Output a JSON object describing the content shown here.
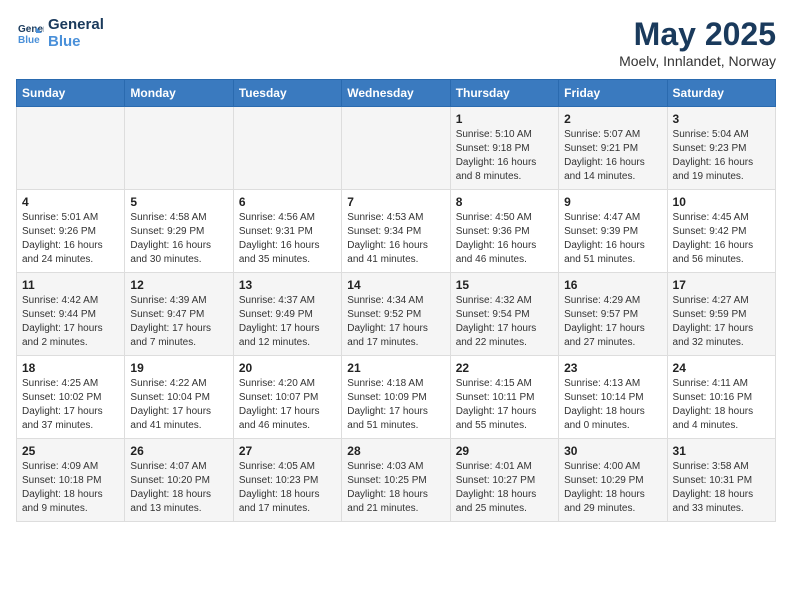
{
  "header": {
    "logo_line1": "General",
    "logo_line2": "Blue",
    "month": "May 2025",
    "location": "Moelv, Innlandet, Norway"
  },
  "days_of_week": [
    "Sunday",
    "Monday",
    "Tuesday",
    "Wednesday",
    "Thursday",
    "Friday",
    "Saturday"
  ],
  "weeks": [
    [
      {
        "day": "",
        "content": ""
      },
      {
        "day": "",
        "content": ""
      },
      {
        "day": "",
        "content": ""
      },
      {
        "day": "",
        "content": ""
      },
      {
        "day": "1",
        "content": "Sunrise: 5:10 AM\nSunset: 9:18 PM\nDaylight: 16 hours\nand 8 minutes."
      },
      {
        "day": "2",
        "content": "Sunrise: 5:07 AM\nSunset: 9:21 PM\nDaylight: 16 hours\nand 14 minutes."
      },
      {
        "day": "3",
        "content": "Sunrise: 5:04 AM\nSunset: 9:23 PM\nDaylight: 16 hours\nand 19 minutes."
      }
    ],
    [
      {
        "day": "4",
        "content": "Sunrise: 5:01 AM\nSunset: 9:26 PM\nDaylight: 16 hours\nand 24 minutes."
      },
      {
        "day": "5",
        "content": "Sunrise: 4:58 AM\nSunset: 9:29 PM\nDaylight: 16 hours\nand 30 minutes."
      },
      {
        "day": "6",
        "content": "Sunrise: 4:56 AM\nSunset: 9:31 PM\nDaylight: 16 hours\nand 35 minutes."
      },
      {
        "day": "7",
        "content": "Sunrise: 4:53 AM\nSunset: 9:34 PM\nDaylight: 16 hours\nand 41 minutes."
      },
      {
        "day": "8",
        "content": "Sunrise: 4:50 AM\nSunset: 9:36 PM\nDaylight: 16 hours\nand 46 minutes."
      },
      {
        "day": "9",
        "content": "Sunrise: 4:47 AM\nSunset: 9:39 PM\nDaylight: 16 hours\nand 51 minutes."
      },
      {
        "day": "10",
        "content": "Sunrise: 4:45 AM\nSunset: 9:42 PM\nDaylight: 16 hours\nand 56 minutes."
      }
    ],
    [
      {
        "day": "11",
        "content": "Sunrise: 4:42 AM\nSunset: 9:44 PM\nDaylight: 17 hours\nand 2 minutes."
      },
      {
        "day": "12",
        "content": "Sunrise: 4:39 AM\nSunset: 9:47 PM\nDaylight: 17 hours\nand 7 minutes."
      },
      {
        "day": "13",
        "content": "Sunrise: 4:37 AM\nSunset: 9:49 PM\nDaylight: 17 hours\nand 12 minutes."
      },
      {
        "day": "14",
        "content": "Sunrise: 4:34 AM\nSunset: 9:52 PM\nDaylight: 17 hours\nand 17 minutes."
      },
      {
        "day": "15",
        "content": "Sunrise: 4:32 AM\nSunset: 9:54 PM\nDaylight: 17 hours\nand 22 minutes."
      },
      {
        "day": "16",
        "content": "Sunrise: 4:29 AM\nSunset: 9:57 PM\nDaylight: 17 hours\nand 27 minutes."
      },
      {
        "day": "17",
        "content": "Sunrise: 4:27 AM\nSunset: 9:59 PM\nDaylight: 17 hours\nand 32 minutes."
      }
    ],
    [
      {
        "day": "18",
        "content": "Sunrise: 4:25 AM\nSunset: 10:02 PM\nDaylight: 17 hours\nand 37 minutes."
      },
      {
        "day": "19",
        "content": "Sunrise: 4:22 AM\nSunset: 10:04 PM\nDaylight: 17 hours\nand 41 minutes."
      },
      {
        "day": "20",
        "content": "Sunrise: 4:20 AM\nSunset: 10:07 PM\nDaylight: 17 hours\nand 46 minutes."
      },
      {
        "day": "21",
        "content": "Sunrise: 4:18 AM\nSunset: 10:09 PM\nDaylight: 17 hours\nand 51 minutes."
      },
      {
        "day": "22",
        "content": "Sunrise: 4:15 AM\nSunset: 10:11 PM\nDaylight: 17 hours\nand 55 minutes."
      },
      {
        "day": "23",
        "content": "Sunrise: 4:13 AM\nSunset: 10:14 PM\nDaylight: 18 hours\nand 0 minutes."
      },
      {
        "day": "24",
        "content": "Sunrise: 4:11 AM\nSunset: 10:16 PM\nDaylight: 18 hours\nand 4 minutes."
      }
    ],
    [
      {
        "day": "25",
        "content": "Sunrise: 4:09 AM\nSunset: 10:18 PM\nDaylight: 18 hours\nand 9 minutes."
      },
      {
        "day": "26",
        "content": "Sunrise: 4:07 AM\nSunset: 10:20 PM\nDaylight: 18 hours\nand 13 minutes."
      },
      {
        "day": "27",
        "content": "Sunrise: 4:05 AM\nSunset: 10:23 PM\nDaylight: 18 hours\nand 17 minutes."
      },
      {
        "day": "28",
        "content": "Sunrise: 4:03 AM\nSunset: 10:25 PM\nDaylight: 18 hours\nand 21 minutes."
      },
      {
        "day": "29",
        "content": "Sunrise: 4:01 AM\nSunset: 10:27 PM\nDaylight: 18 hours\nand 25 minutes."
      },
      {
        "day": "30",
        "content": "Sunrise: 4:00 AM\nSunset: 10:29 PM\nDaylight: 18 hours\nand 29 minutes."
      },
      {
        "day": "31",
        "content": "Sunrise: 3:58 AM\nSunset: 10:31 PM\nDaylight: 18 hours\nand 33 minutes."
      }
    ]
  ]
}
